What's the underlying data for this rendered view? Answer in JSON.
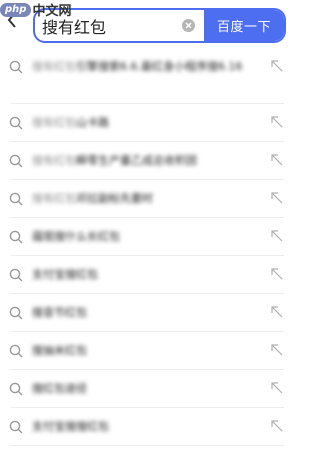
{
  "watermark": {
    "badge": "php",
    "text": "中文网"
  },
  "search": {
    "value": "搜有红包",
    "button_label": "百度一下"
  },
  "suggestions": [
    {
      "prefix": "搜有红包",
      "main": "引擎搜索6.6.最红身小程序搜6.16",
      "tall": true
    },
    {
      "prefix": "搜有红包",
      "main": "山卡路",
      "tall": false
    },
    {
      "prefix": "搜有红包",
      "main": "瞬零生产量乙成总收积团",
      "tall": false
    },
    {
      "prefix": "搜有红包",
      "main": "邓拉副标先要时",
      "tall": false
    },
    {
      "prefix": "",
      "main": "蕴珉搜什么长红包",
      "tall": false
    },
    {
      "prefix": "",
      "main": "支付宝搜红包",
      "tall": false
    },
    {
      "prefix": "",
      "main": "搜音节红包",
      "tall": false
    },
    {
      "prefix": "",
      "main": "搜抽米红包",
      "tall": false
    },
    {
      "prefix": "",
      "main": "搜红包途径",
      "tall": false
    },
    {
      "prefix": "",
      "main": "支付宝搜搜红包",
      "tall": false
    }
  ],
  "colors": {
    "accent": "#4e6ef2",
    "icon": "#9a9a9a",
    "divider": "#eeeeee"
  }
}
